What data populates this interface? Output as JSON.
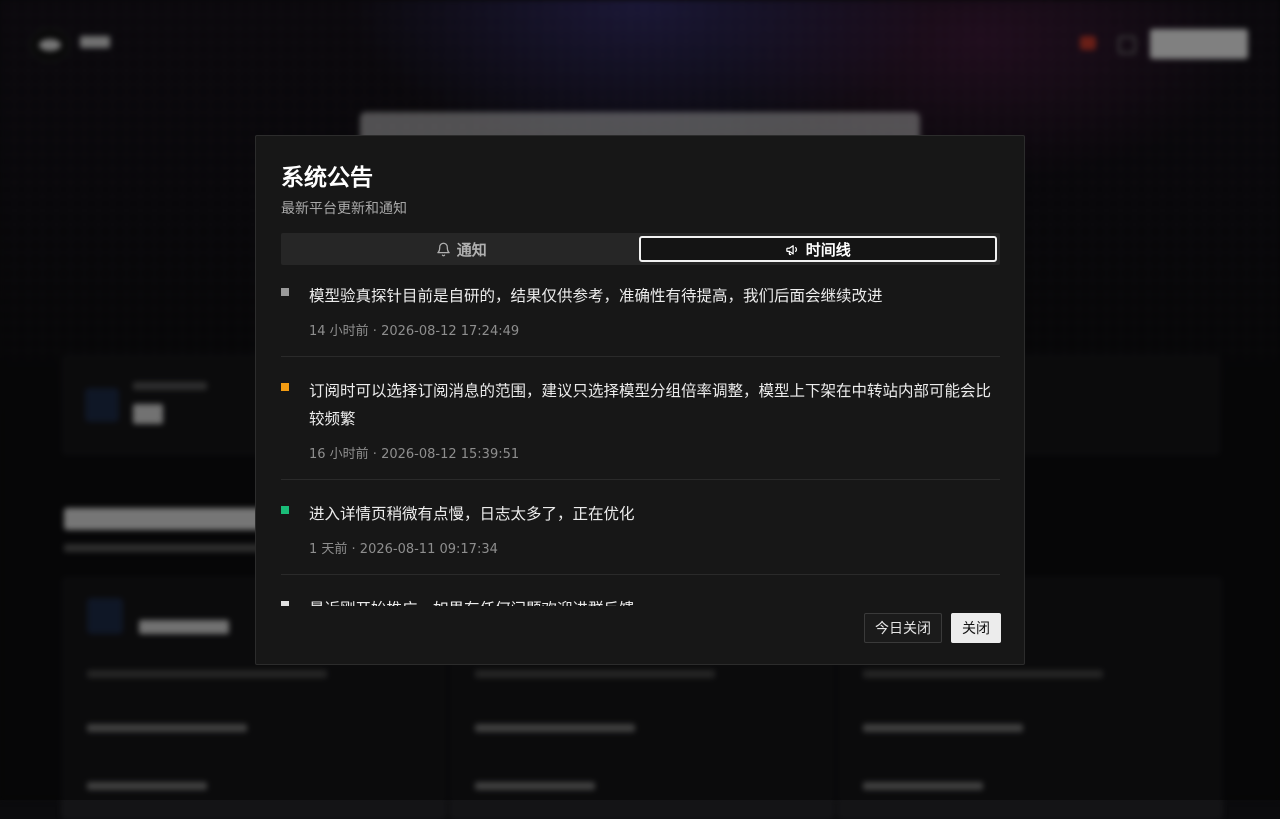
{
  "modal": {
    "title": "系统公告",
    "subtitle": "最新平台更新和通知",
    "tabs": [
      {
        "label": "通知",
        "icon": "bell-icon",
        "active": false
      },
      {
        "label": "时间线",
        "icon": "megaphone-icon",
        "active": true
      }
    ],
    "announcements": [
      {
        "text": "模型验真探针目前是自研的，结果仅供参考，准确性有待提高，我们后面会继续改进",
        "time": "14 小时前 · 2026-08-12 17:24:49",
        "dot_color": "#9a9a9a"
      },
      {
        "text": "订阅时可以选择订阅消息的范围，建议只选择模型分组倍率调整，模型上下架在中转站内部可能会比较频繁",
        "time": "16 小时前 · 2026-08-12 15:39:51",
        "dot_color": "#f39c12"
      },
      {
        "text": "进入详情页稍微有点慢，日志太多了，正在优化",
        "time": "1 天前 · 2026-08-11 09:17:34",
        "dot_color": "#1abc78"
      },
      {
        "text": "最近刚开始推广，如果有任何问题欢迎进群反馈",
        "time": "",
        "dot_color": "#e0e0e0"
      }
    ],
    "buttons": {
      "today_close": "今日关闭",
      "close": "关闭"
    }
  }
}
